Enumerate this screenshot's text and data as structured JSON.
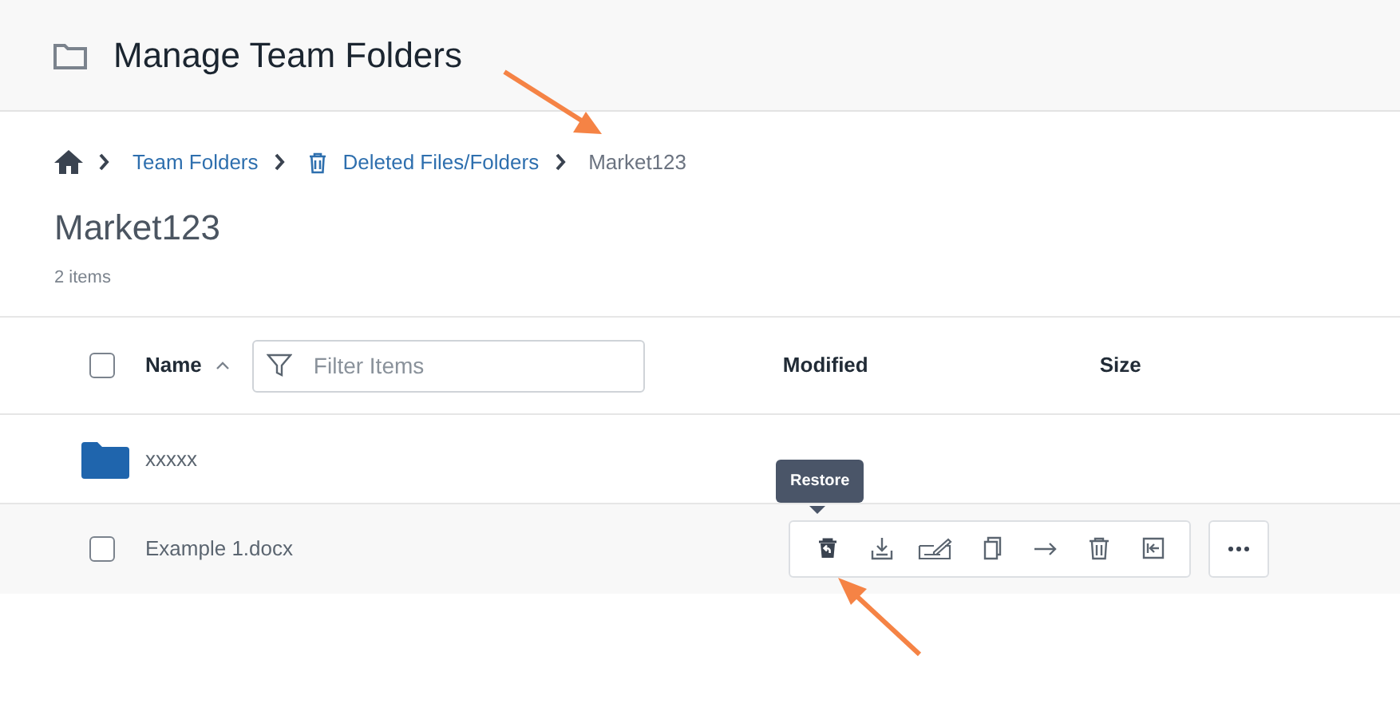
{
  "header": {
    "title": "Manage Team Folders"
  },
  "breadcrumb": [
    {
      "kind": "home"
    },
    {
      "kind": "link",
      "label": "Team Folders"
    },
    {
      "kind": "trash-link",
      "label": "Deleted Files/Folders"
    },
    {
      "kind": "current",
      "label": "Market123"
    }
  ],
  "folder_title": "Market123",
  "item_count": "2 items",
  "table": {
    "select_all": {
      "checked": false
    },
    "columns": [
      {
        "label": "Name",
        "sorted": true
      },
      {
        "label": "Modified"
      },
      {
        "label": "Size"
      }
    ],
    "filter": {
      "placeholder": "Filter Items"
    },
    "rows": [
      {
        "kind": "folder",
        "name": "xxxxx",
        "hovered": false
      },
      {
        "kind": "file",
        "name": "Example 1.docx",
        "checked": false,
        "hovered": true
      }
    ]
  },
  "tooltip": "Restore"
}
